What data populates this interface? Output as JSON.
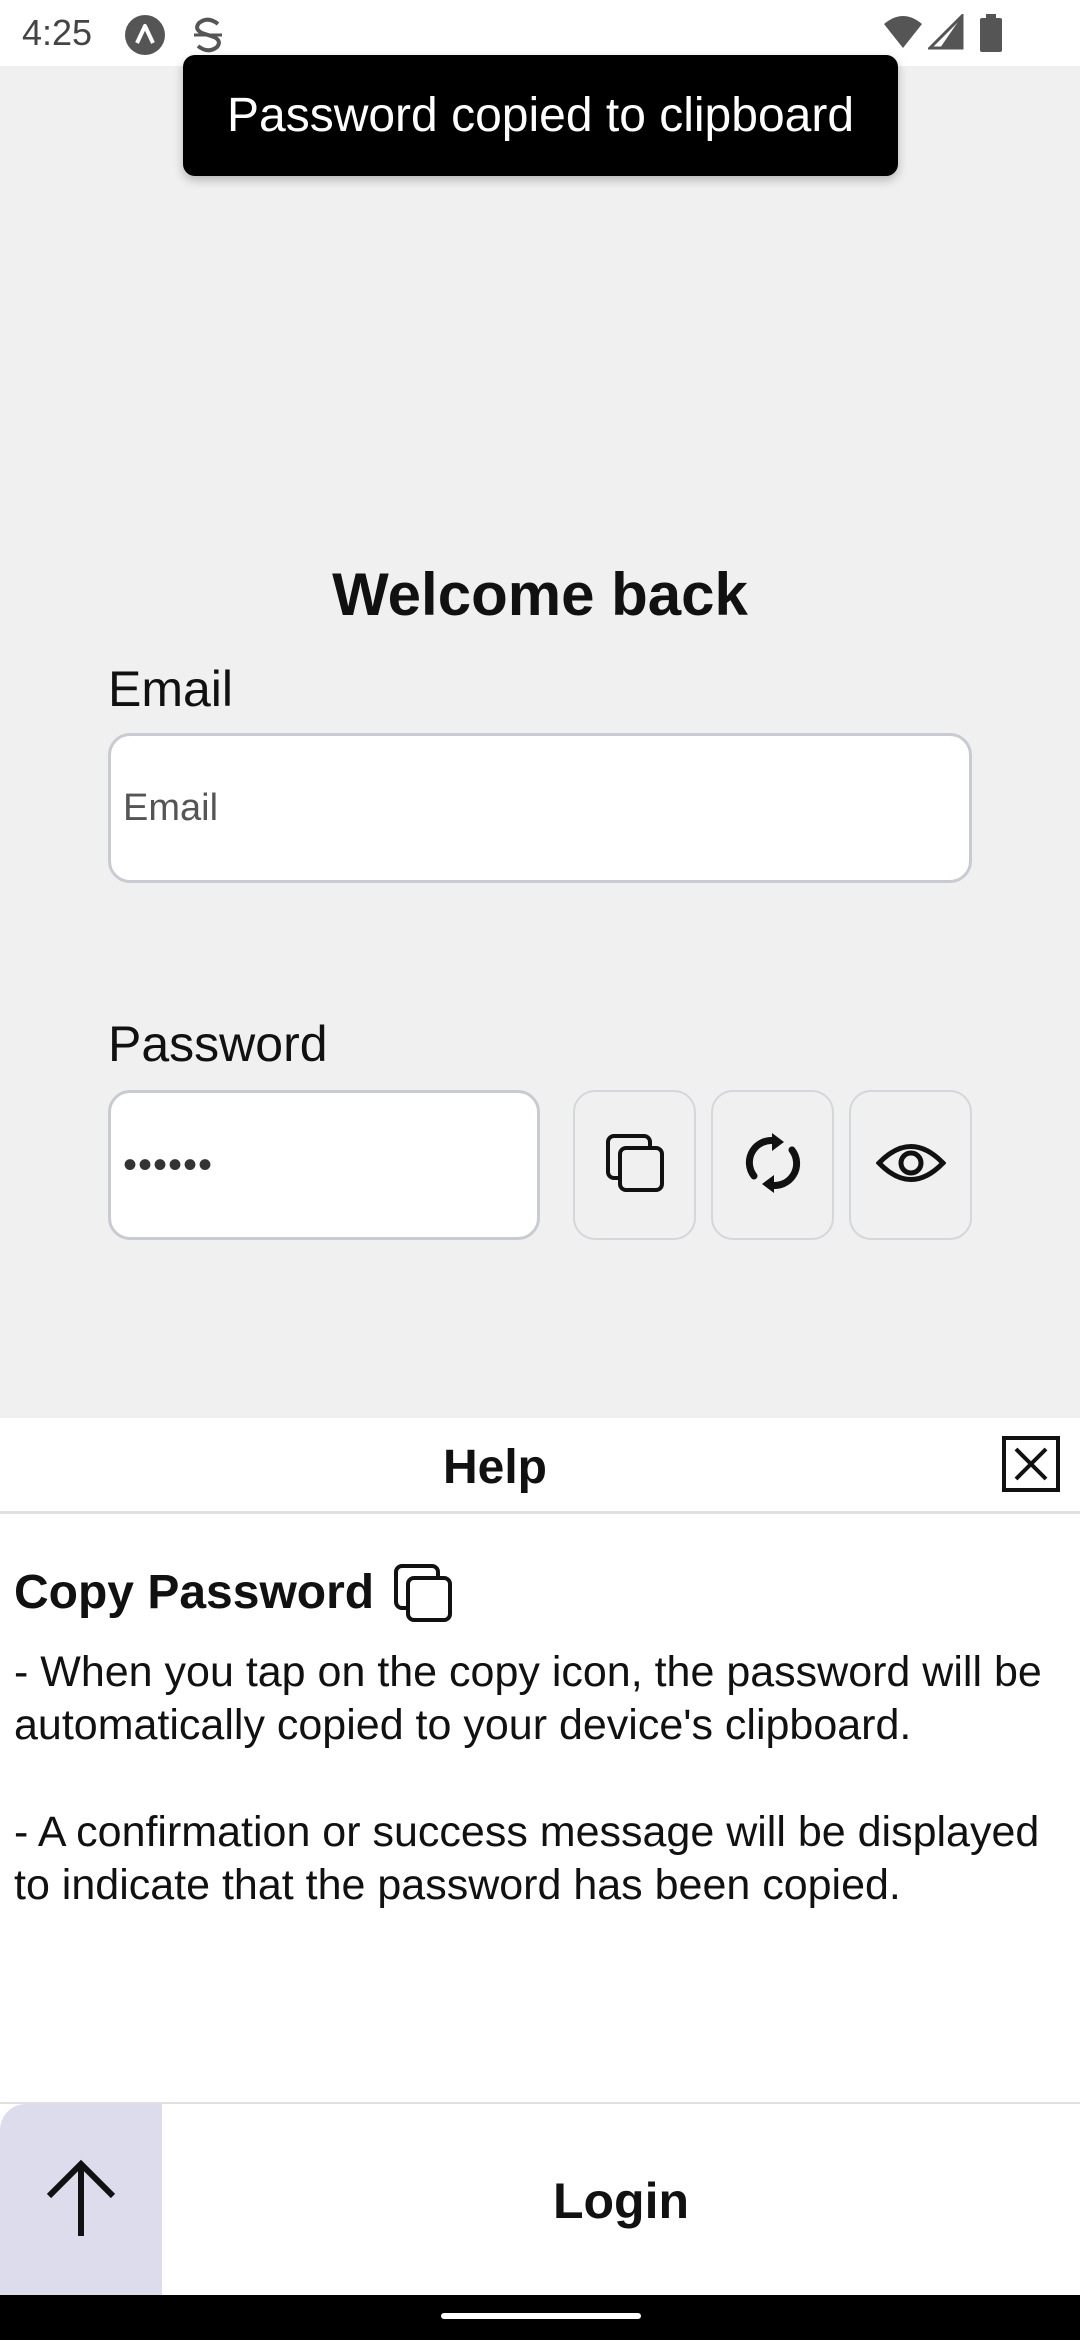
{
  "status_bar": {
    "time": "4:25",
    "icons": [
      "app-a-icon",
      "sync-s-icon",
      "wifi-icon",
      "signal-icon",
      "battery-icon"
    ]
  },
  "toast": {
    "message": "Password copied to clipboard"
  },
  "form": {
    "title": "Welcome back",
    "email_label": "Email",
    "email_placeholder": "Email",
    "email_value": "",
    "password_label": "Password",
    "password_value": "••••••",
    "buttons": [
      "copy-icon",
      "refresh-icon",
      "eye-icon"
    ]
  },
  "help": {
    "title": "Help",
    "section_title": "Copy Password",
    "paragraph_1": "- When you tap on the copy icon, the password will be automatically copied to your device's clipboard.",
    "paragraph_2": "- A confirmation or success message will be displayed to indicate that the password has been copied."
  },
  "bottom_bar": {
    "login_label": "Login"
  },
  "colors": {
    "toast_bg": "#000000",
    "up_button_bg": "#dcdcec",
    "input_border": "#c8cbd3",
    "page_bg": "#f0f0f0"
  }
}
